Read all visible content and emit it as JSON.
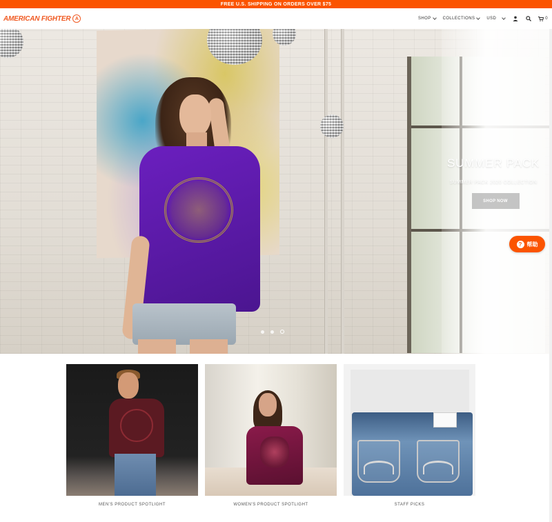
{
  "announcement": {
    "text": "FREE U.S. SHIPPING ON ORDERS OVER $75"
  },
  "header": {
    "logo_text": "AMERICAN FIGHTER",
    "logo_mark": "A",
    "nav": [
      {
        "label": "SHOP",
        "has_dropdown": true
      },
      {
        "label": "COLLECTIONS",
        "has_dropdown": true
      },
      {
        "label": "USD",
        "has_dropdown": true
      }
    ],
    "icons": [
      "user-icon",
      "search-icon",
      "cart-icon"
    ],
    "cart_count": "0"
  },
  "hero": {
    "title": "SUMMER PACK",
    "subtitle": "SUMMER PACK 2020 COLLECTION",
    "button_label": "SHOP NOW",
    "slides_total": 3,
    "active_slide": 3
  },
  "help_widget": {
    "icon": "?",
    "label": "帮助"
  },
  "tiles": [
    {
      "caption": "MEN'S PRODUCT SPOTLIGHT"
    },
    {
      "caption": "WOMEN'S PRODUCT SPOTLIGHT"
    },
    {
      "caption": "STAFF PICKS"
    }
  ],
  "colors": {
    "brand_orange": "#fb5400",
    "logo_orange": "#f05a22",
    "shirt_purple": "#5a1aa6"
  }
}
